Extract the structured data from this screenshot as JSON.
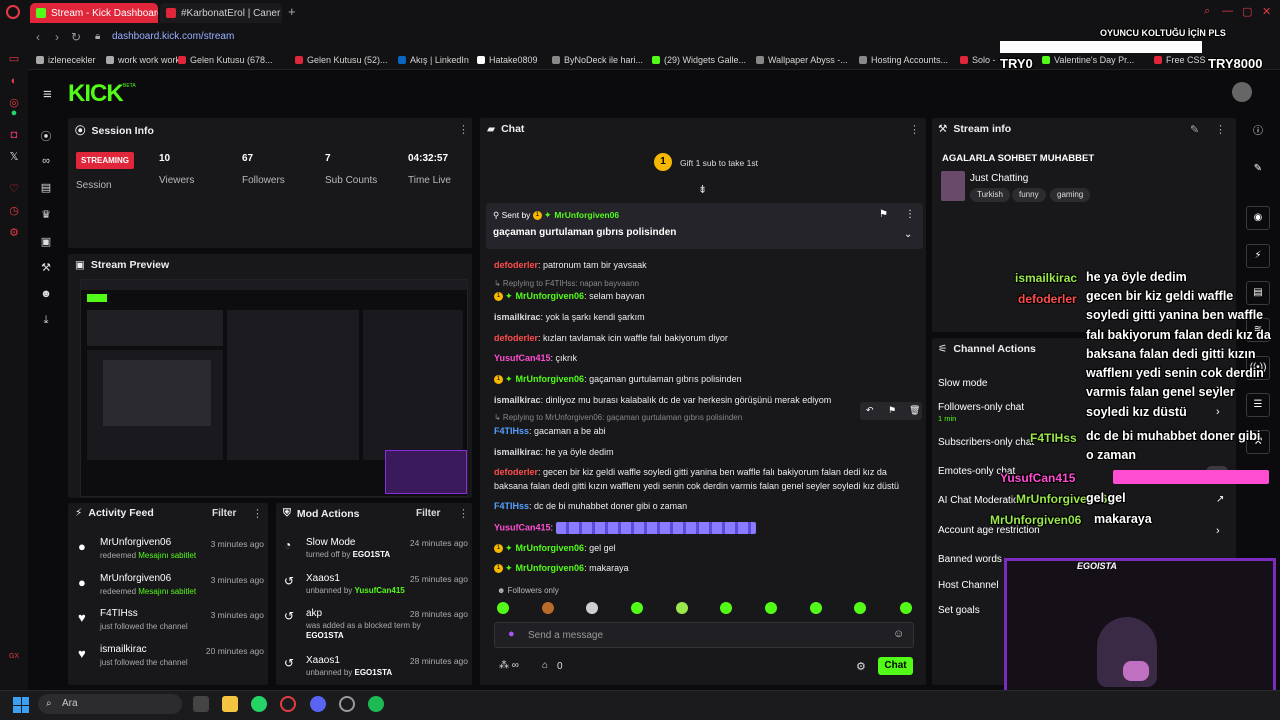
{
  "browser": {
    "tabs": [
      {
        "label": "Stream - Kick Dashboard",
        "color": "#53fc18",
        "active": true
      },
      {
        "label": "#KarbonatErol | Caner Eri",
        "color": "#e0263a",
        "active": false
      }
    ],
    "url": "dashboard.kick.com/stream",
    "bookmarks": [
      {
        "label": "izlenecekler",
        "color": "#aaaaaa"
      },
      {
        "label": "work work work",
        "color": "#aaaaaa"
      },
      {
        "label": "Gelen Kutusu (678...",
        "color": "#e0263a"
      },
      {
        "label": "Gelen Kutusu (52)...",
        "color": "#e0263a"
      },
      {
        "label": "Akış | LinkedIn",
        "color": "#0a66c2"
      },
      {
        "label": "Hatake0809",
        "color": "#ffffff"
      },
      {
        "label": "ByNoDeck ile hari...",
        "color": "#888888"
      },
      {
        "label": "(29) Widgets Galle...",
        "color": "#53fc18"
      },
      {
        "label": "Wallpaper Abyss -...",
        "color": "#888888"
      },
      {
        "label": "Hosting Accounts...",
        "color": "#888888"
      },
      {
        "label": "Solo -",
        "color": "#e0263a"
      },
      {
        "label": "Valentine's Day Pr...",
        "color": "#53fc18"
      },
      {
        "label": "Free CSS",
        "color": "#e0263a"
      }
    ],
    "overlay_top": {
      "chair": "OYUNCU KOLTUĞU İÇİN PLS",
      "left": "TRY0",
      "right": "TRY8000"
    }
  },
  "kick": {
    "logo": "KICK",
    "beta": "BETA"
  },
  "session": {
    "title": "Session Info",
    "badge": "STREAMING",
    "badge_label": "Session",
    "stats": [
      {
        "value": "10",
        "label": "Viewers"
      },
      {
        "value": "67",
        "label": "Followers"
      },
      {
        "value": "7",
        "label": "Sub Counts"
      },
      {
        "value": "04:32:57",
        "label": "Time Live"
      }
    ]
  },
  "preview": {
    "title": "Stream Preview"
  },
  "activity": {
    "title": "Activity Feed",
    "filter": "Filter",
    "items": [
      {
        "name": "MrUnforgiven06",
        "sub_prefix": "redeemed ",
        "sub_highlight": "Mesajını sabitlet",
        "time": "3 minutes ago",
        "icon": "●"
      },
      {
        "name": "MrUnforgiven06",
        "sub_prefix": "redeemed ",
        "sub_highlight": "Mesajını sabitlet",
        "time": "3 minutes ago",
        "icon": "●"
      },
      {
        "name": "F4TIHss",
        "sub_prefix": "just followed the channel",
        "sub_highlight": "",
        "time": "3 minutes ago",
        "icon": "♥"
      },
      {
        "name": "ismailkirac",
        "sub_prefix": "just followed the channel",
        "sub_highlight": "",
        "time": "20 minutes ago",
        "icon": "♥"
      }
    ]
  },
  "mod": {
    "title": "Mod Actions",
    "filter": "Filter",
    "items": [
      {
        "name": "Slow Mode",
        "sub": "turned off by ",
        "by": "EGO1STA",
        "time": "24 minutes ago",
        "icon": "◔"
      },
      {
        "name": "Xaaos1",
        "sub": "unbanned by ",
        "by": "YusufCan415",
        "time": "25 minutes ago",
        "icon": "↺"
      },
      {
        "name": "akp",
        "sub": "was added as a blocked term by",
        "by": "EGO1STA",
        "time": "28 minutes ago",
        "icon": "↺"
      },
      {
        "name": "Xaaos1",
        "sub": "unbanned by ",
        "by": "EGO1STA",
        "time": "28 minutes ago",
        "icon": "↺"
      }
    ]
  },
  "chat": {
    "title": "Chat",
    "gift": "Gift 1 sub to take 1st",
    "gift_count": "1",
    "pinned_sent_by": "Sent by",
    "pinned_user": "MrUnforgiven06",
    "pinned_msg": "gaçaman gurtulaman gıbrıs polisinden",
    "messages": [
      {
        "user": "defoderler",
        "color": "#ff4d4d",
        "text": "patronum tam bir yavsaak",
        "badges": false
      },
      {
        "reply": "Replying to F4TIHss: napan bayvaann"
      },
      {
        "user": "MrUnforgiven06",
        "color": "#53fc18",
        "text": "selam bayvan",
        "badges": true
      },
      {
        "user": "ismailkirac",
        "color": "#d9d9d9",
        "text": "yok la şarkı kendi şarkım",
        "badges": false
      },
      {
        "user": "defoderler",
        "color": "#ff4d4d",
        "text": "kızları tavlamak icin waffle falı bakiyorum diyor",
        "badges": false
      },
      {
        "user": "YusufCan415",
        "color": "#ff4dd2",
        "text": "çıkrık",
        "badges": false
      },
      {
        "user": "MrUnforgiven06",
        "color": "#53fc18",
        "text": "gaçaman gurtulaman gıbrıs polisinden",
        "badges": true
      },
      {
        "user": "ismailkirac",
        "color": "#d9d9d9",
        "text": "dinliyoz mu burası kalabalık dc de var herkesin görüşünü merak ediyom",
        "badges": false
      },
      {
        "reply": "Replying to MrUnforgiven06: gaçaman gurtulaman gıbrıs polisinden"
      },
      {
        "user": "F4TIHss",
        "color": "#54a0ff",
        "text": "gacaman a be abi",
        "badges": false
      },
      {
        "user": "ismailkirac",
        "color": "#d9d9d9",
        "text": "he ya öyle dedim",
        "badges": false
      },
      {
        "user": "defoderler",
        "color": "#ff4d4d",
        "text": "gecen bir kiz geldi waffle soyledi gitti yanina ben waffle falı bakiyorum falan dedi kız da",
        "badges": false
      },
      {
        "cont": "baksana falan dedi gitti kızın wafflenı yedi senin cok derdin varmis falan genel seyler soyledi kız düstü"
      },
      {
        "user": "F4TIHss",
        "color": "#54a0ff",
        "text": "dc de bi muhabbet doner gibi o zaman",
        "badges": false
      },
      {
        "user": "YusufCan415",
        "color": "#ff4dd2",
        "text": "",
        "emotes": true,
        "badges": false
      },
      {
        "user": "MrUnforgiven06",
        "color": "#53fc18",
        "text": "gel gel",
        "badges": true
      },
      {
        "user": "MrUnforgiven06",
        "color": "#53fc18",
        "text": "makaraya",
        "badges": true
      }
    ],
    "followers_only": "Followers only",
    "placeholder": "Send a message",
    "bottom_count": "0",
    "send": "Chat"
  },
  "stream_info": {
    "title": "Stream info",
    "stream_title": "AGALARLA SOHBET MUHABBET",
    "category": "Just Chatting",
    "tags": [
      "Turkish",
      "funny",
      "gaming"
    ]
  },
  "channel_actions": {
    "title": "Channel Actions",
    "items": [
      "Slow mode",
      "Followers-only chat",
      "Subscribers-only chat",
      "Emotes-only chat",
      "AI Chat Moderation",
      "Account age restriction",
      "Banned words",
      "Host Channel",
      "Set goals"
    ],
    "followers_sub": "1 min"
  },
  "overlay_chat": [
    {
      "user": "ismailkirac",
      "color": "#9be84c",
      "text": "he ya öyle dedim"
    },
    {
      "user": "defoderler",
      "color": "#ff4d4d",
      "text": "gecen bir kiz geldi waffle soyledi gitti yanina ben waffle falı bakiyorum falan dedi kız da baksana falan dedi gitti kızın wafflenı yedi senin cok derdin varmis falan genel seyler soyledi kız düstü"
    },
    {
      "user": "F4TIHss",
      "color": "#9be84c",
      "text": "dc de bi muhabbet doner gibi o zaman"
    },
    {
      "user": "YusufCan415",
      "color": "#ff4dd2",
      "text": ""
    },
    {
      "user": "MrUnforgiven06",
      "color": "#9be84c",
      "text": "gel gel"
    },
    {
      "user": "MrUnforgiven06",
      "color": "#9be84c",
      "text": "makaraya"
    }
  ],
  "webcam_label": "EGOISTA",
  "taskbar": {
    "search": "Ara"
  }
}
